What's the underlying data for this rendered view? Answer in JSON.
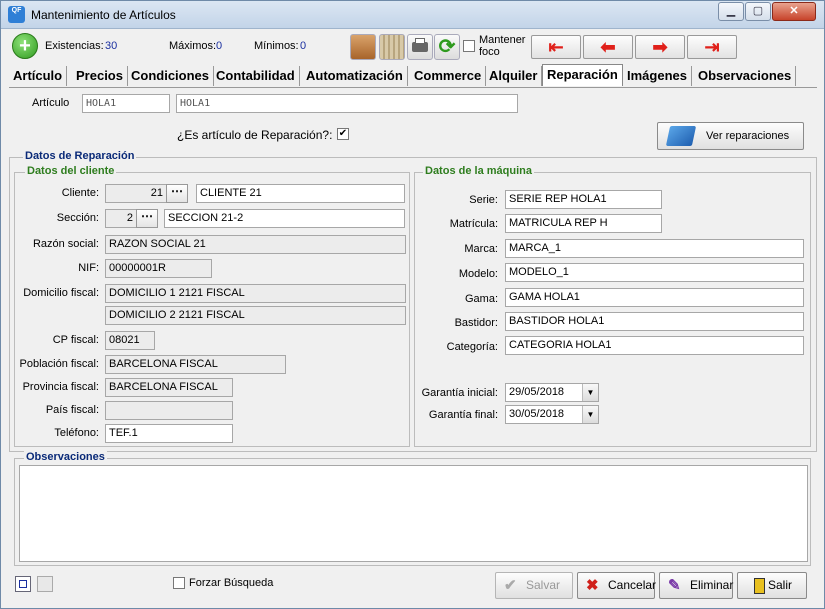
{
  "window": {
    "title": "Mantenimiento de Artículos",
    "logo": "QF"
  },
  "title_controls": {
    "minimize": "▁",
    "maximize": "▢",
    "close": "✕"
  },
  "toolbar": {
    "existencias_label": "Existencias:",
    "existencias_value": "30",
    "maximos_label": "Máximos:",
    "maximos_value": "0",
    "minimos_label": "Mínimos:",
    "minimos_value": "0",
    "mantener_line1": "Mantener",
    "mantener_line2": "foco",
    "nav_first": "⇤",
    "nav_prev": "⬅",
    "nav_next": "➡",
    "nav_last": "⇥"
  },
  "tabs": [
    "Artículo",
    "Precios",
    "Condiciones",
    "Contabilidad",
    "Automatización",
    "Commerce",
    "Alquiler",
    "Reparación",
    "Imágenes",
    "Observaciones"
  ],
  "article": {
    "label": "Artículo",
    "code": "HOLA1",
    "description": "HOLA1"
  },
  "reparacion": {
    "question": "¿Es artículo de Reparación?:",
    "checked": "✔",
    "ver_button": "Ver reparaciones"
  },
  "datos_reparacion_title": "Datos de Reparación",
  "cliente": {
    "title": "Datos del cliente",
    "cliente_label": "Cliente:",
    "cliente_code": "21",
    "cliente_name": "CLIENTE 21",
    "seccion_label": "Sección:",
    "seccion_code": "2",
    "seccion_name": "SECCION 21-2",
    "razon_label": "Razón social:",
    "razon": "RAZON SOCIAL 21",
    "nif_label": "NIF:",
    "nif": "00000001R",
    "domicilio_label": "Domicilio fiscal:",
    "domicilio1": "DOMICILIO 1 2121 FISCAL",
    "domicilio2": "DOMICILIO 2 2121 FISCAL",
    "cp_label": "CP fiscal:",
    "cp": "08021",
    "poblacion_label": "Población fiscal:",
    "poblacion": "BARCELONA FISCAL",
    "provincia_label": "Provincia fiscal:",
    "provincia": "BARCELONA FISCAL",
    "pais_label": "País fiscal:",
    "pais": "",
    "telefono_label": "Teléfono:",
    "telefono": "TEF.1"
  },
  "maquina": {
    "title": "Datos de la máquina",
    "serie_label": "Serie:",
    "serie": "SERIE REP HOLA1",
    "matricula_label": "Matrícula:",
    "matricula": "MATRICULA REP H",
    "marca_label": "Marca:",
    "marca": "MARCA_1",
    "modelo_label": "Modelo:",
    "modelo": "MODELO_1",
    "gama_label": "Gama:",
    "gama": "GAMA HOLA1",
    "bastidor_label": "Bastidor:",
    "bastidor": "BASTIDOR HOLA1",
    "categoria_label": "Categoría:",
    "categoria": "CATEGORIA HOLA1",
    "garantia_inicial_label": "Garantía inicial:",
    "garantia_inicial": "29/05/2018",
    "garantia_final_label": "Garantía final:",
    "garantia_final": "30/05/2018"
  },
  "observaciones": {
    "title": "Observaciones",
    "text": ""
  },
  "footer": {
    "forzar_label": "Forzar Búsqueda",
    "salvar": "Salvar",
    "cancelar": "Cancelar",
    "eliminar": "Eliminar",
    "salir": "Salir"
  },
  "colors": {
    "accent_blue": "#1a2fa0",
    "group_title_green": "#2e7d1e",
    "group_title_navy": "#0a2a78",
    "nav_red": "#e0201a"
  }
}
